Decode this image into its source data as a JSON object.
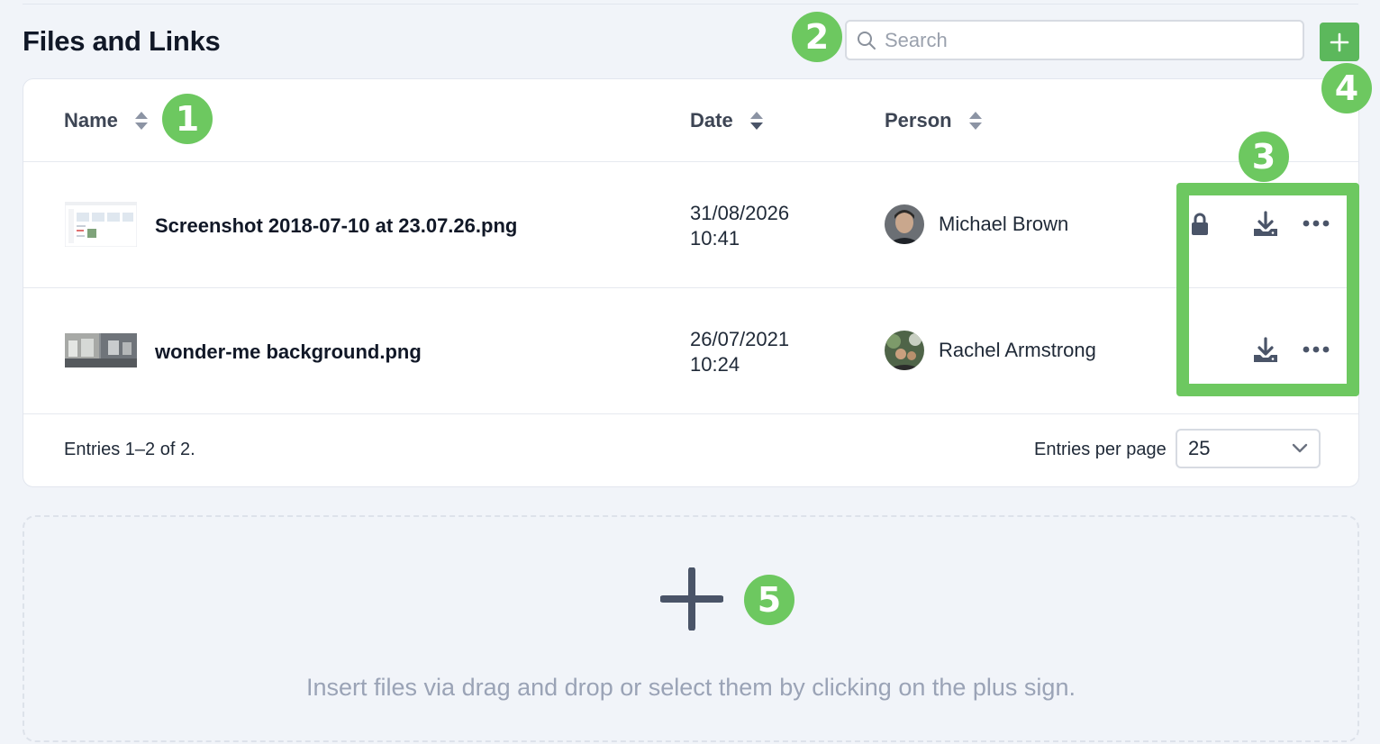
{
  "page": {
    "title": "Files and Links"
  },
  "search": {
    "placeholder": "Search",
    "value": ""
  },
  "table": {
    "columns": [
      "Name",
      "Date",
      "Person"
    ],
    "rows": [
      {
        "name": "Screenshot 2018-07-10 at 23.07.26.png",
        "date": "31/08/2026",
        "time": "10:41",
        "person": "Michael Brown",
        "locked": true
      },
      {
        "name": "wonder-me background.png",
        "date": "26/07/2021",
        "time": "10:24",
        "person": "Rachel Armstrong",
        "locked": false
      }
    ]
  },
  "footer": {
    "entries": "Entries 1–2 of 2.",
    "per_page_label": "Entries per page",
    "per_page_value": "25"
  },
  "dropzone": {
    "text": "Insert files via drag and drop or select them by clicking on the plus sign."
  },
  "callouts": [
    "1",
    "2",
    "3",
    "4",
    "5"
  ],
  "icons": [
    "search-icon",
    "plus-icon",
    "sort-icon",
    "lock-icon",
    "download-icon",
    "more-icon",
    "chevron-down-icon"
  ],
  "colors": {
    "accent_green": "#6dc860",
    "button_green": "#5cb85c",
    "icon_slate": "#4a5468"
  }
}
